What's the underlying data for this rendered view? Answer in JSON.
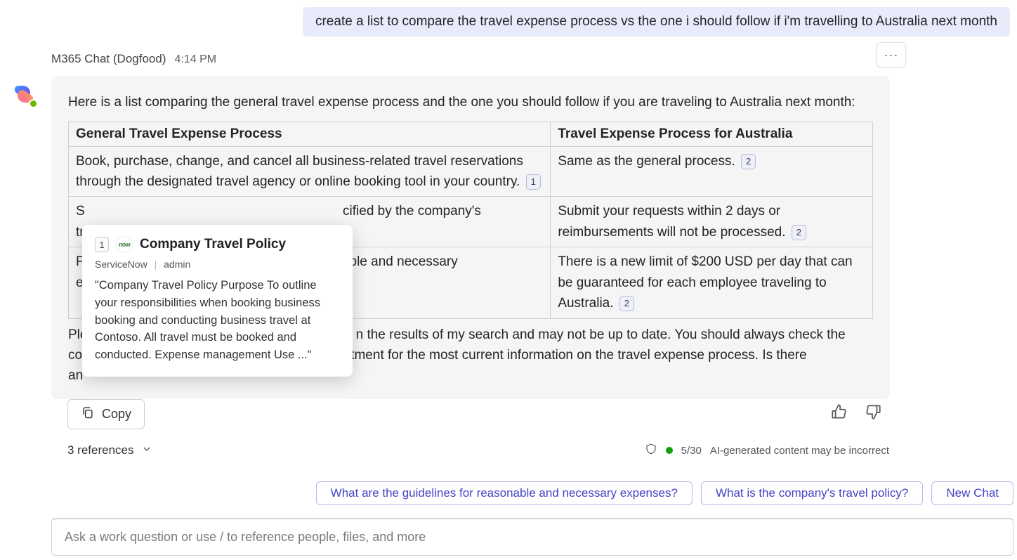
{
  "user_message": "create a list to compare the travel expense process vs the one i should follow if i'm travelling to Australia next month",
  "sender": {
    "name": "M365 Chat (Dogfood)",
    "time": "4:14 PM"
  },
  "more_label": "···",
  "intro": "Here is a list comparing the general travel expense process and the one you should follow if you are traveling to Australia next month:",
  "table": {
    "headers": [
      "General Travel Expense Process",
      "Travel Expense Process for Australia"
    ],
    "rows": [
      {
        "left_text": "Book, purchase, change, and cancel all business-related travel reservations through the designated travel agency or online booking tool in your country.",
        "left_cite": "1",
        "right_text": "Same as the general process.",
        "right_cite": "2"
      },
      {
        "left_text_a": "S",
        "left_text_b": "cified by the company's",
        "left_text_c": "tr",
        "right_text": "Submit your requests within 2 days or reimbursements will not be processed.",
        "right_cite": "2"
      },
      {
        "left_text_a": "F",
        "left_text_b": "able and necessary",
        "left_text_c": "e",
        "right_text": "There is a new limit of $200 USD per day that can be guaranteed for each employee traveling to Australia.",
        "right_cite": "2"
      }
    ]
  },
  "note": "Please note that this list is based on the results of my search and may not be up to date. You should always check the company's travel policy or the HR department for the most current information on the travel expense process. Is there anything else I can help you with?",
  "note_visible_a": "Ple",
  "note_visible_b": "n the results of my search and may not be up to date. You should always check the",
  "note_visible_c": "co",
  "note_visible_d": "tment for the most current information on the travel expense process. Is there",
  "note_visible_e": "an",
  "copy_label": "Copy",
  "refs_label": "3 references",
  "ai_counter": "5/30",
  "ai_disclaimer": "AI-generated content may be incorrect",
  "chips": [
    "What are the guidelines for reasonable and necessary expenses?",
    "What is the company's travel policy?",
    "New Chat"
  ],
  "compose_placeholder": "Ask a work question or use / to reference people, files, and more",
  "hover": {
    "num": "1",
    "logo_text": "now",
    "title": "Company Travel Policy",
    "source": "ServiceNow",
    "author": "admin",
    "body": "\"Company Travel Policy Purpose To outline your responsibilities when booking business booking and conducting business travel at Contoso. All travel must be booked and conducted. Expense management Use ...\""
  }
}
